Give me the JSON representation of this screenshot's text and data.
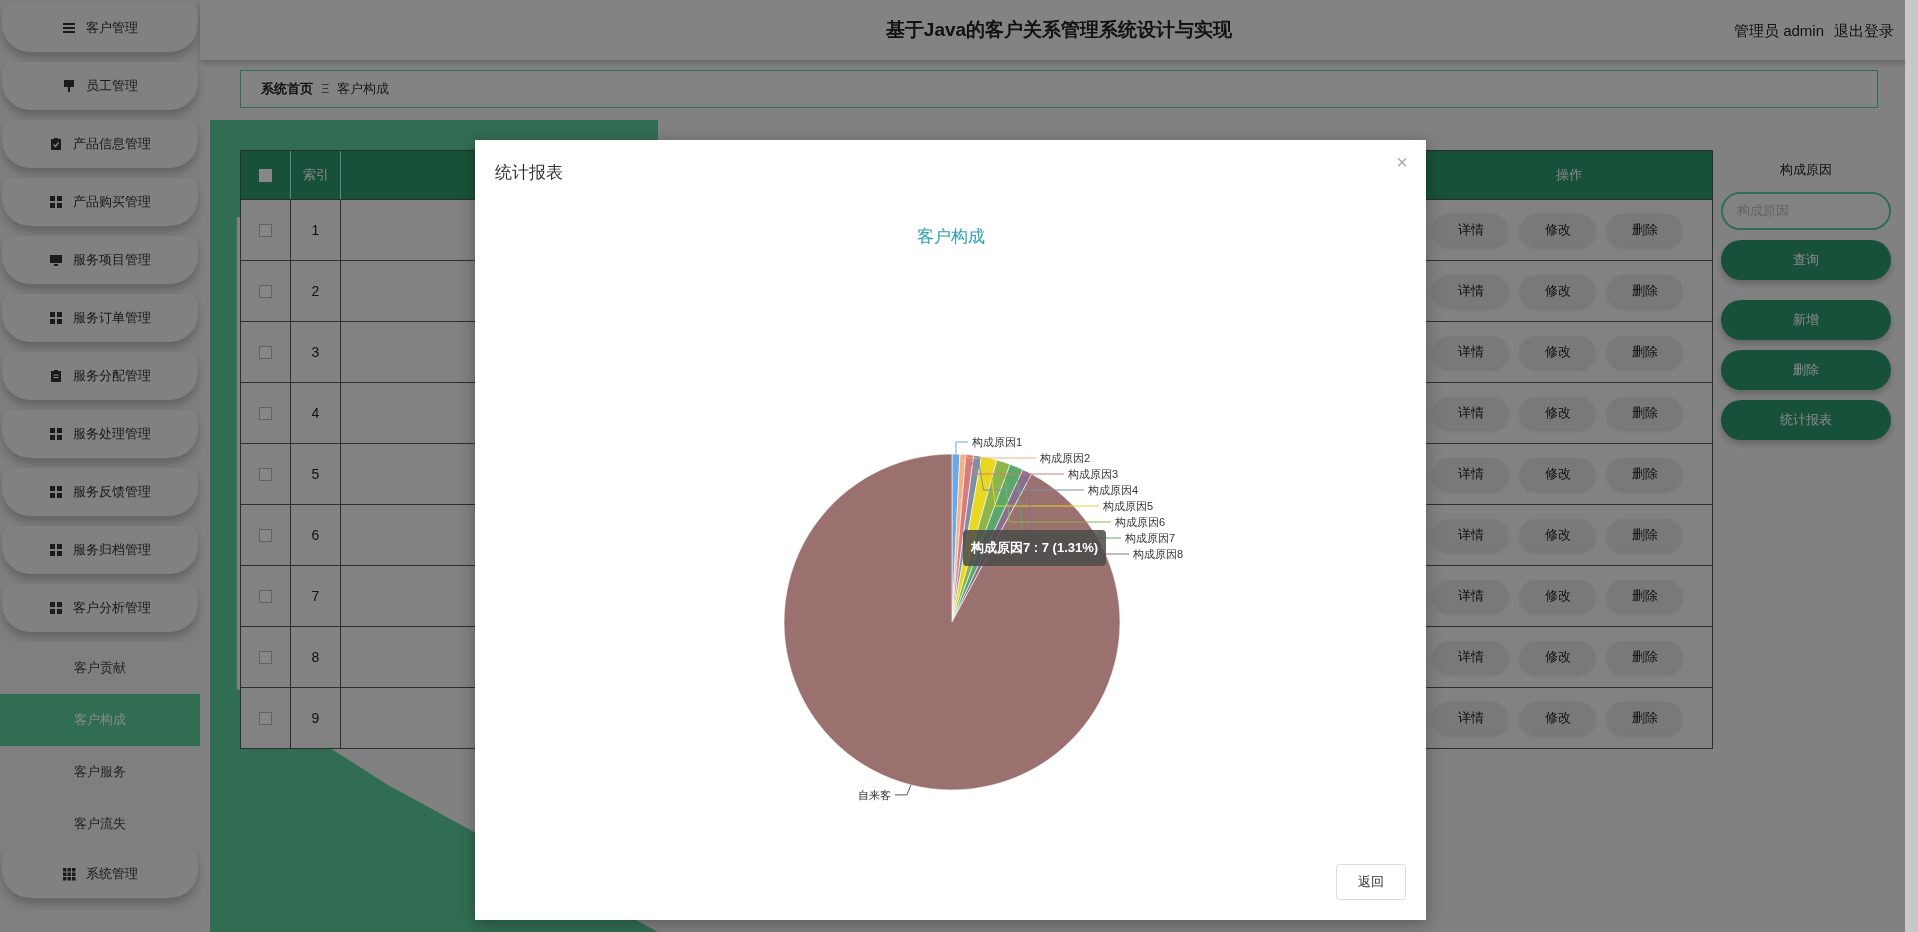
{
  "header": {
    "title": "基于Java的客户关系管理系统设计与实现",
    "user": "管理员 admin",
    "logout": "退出登录"
  },
  "sidebar": {
    "items": [
      {
        "label": "客户管理",
        "kind": "list"
      },
      {
        "label": "员工管理",
        "kind": "stand"
      },
      {
        "label": "产品信息管理",
        "kind": "checklist"
      },
      {
        "label": "产品购买管理",
        "kind": "grid"
      },
      {
        "label": "服务项目管理",
        "kind": "monitor"
      },
      {
        "label": "服务订单管理",
        "kind": "grid"
      },
      {
        "label": "服务分配管理",
        "kind": "clipboard"
      },
      {
        "label": "服务处理管理",
        "kind": "grid"
      },
      {
        "label": "服务反馈管理",
        "kind": "grid"
      },
      {
        "label": "服务归档管理",
        "kind": "grid"
      },
      {
        "label": "客户分析管理",
        "kind": "grid",
        "children": [
          {
            "label": "客户贡献",
            "selected": false
          },
          {
            "label": "客户构成",
            "selected": true
          },
          {
            "label": "客户服务",
            "selected": false
          },
          {
            "label": "客户流失",
            "selected": false
          }
        ]
      },
      {
        "label": "系统管理",
        "kind": "apps"
      }
    ]
  },
  "breadcrumb": {
    "items": [
      "系统首页",
      "客户构成"
    ],
    "separator": "Ξ"
  },
  "table": {
    "header_checkbox": {
      "checked": false
    },
    "columns": [
      "索引",
      "操作"
    ],
    "rows": [
      {
        "index": "1",
        "checked": false,
        "actions": [
          "详情",
          "修改",
          "删除"
        ]
      },
      {
        "index": "2",
        "checked": false,
        "actions": [
          "详情",
          "修改",
          "删除"
        ]
      },
      {
        "index": "3",
        "checked": false,
        "actions": [
          "详情",
          "修改",
          "删除"
        ]
      },
      {
        "index": "4",
        "checked": false,
        "actions": [
          "详情",
          "修改",
          "删除"
        ]
      },
      {
        "index": "5",
        "checked": false,
        "actions": [
          "详情",
          "修改",
          "删除"
        ]
      },
      {
        "index": "6",
        "checked": false,
        "actions": [
          "详情",
          "修改",
          "删除"
        ]
      },
      {
        "index": "7",
        "checked": false,
        "actions": [
          "详情",
          "修改",
          "删除"
        ]
      },
      {
        "index": "8",
        "checked": false,
        "actions": [
          "详情",
          "修改",
          "删除"
        ]
      },
      {
        "index": "9",
        "checked": false,
        "actions": [
          "详情",
          "修改",
          "删除"
        ]
      }
    ]
  },
  "search": {
    "label": "构成原因",
    "placeholder": "构成原因",
    "buttons": [
      "查询",
      "新增",
      "删除",
      "统计报表"
    ]
  },
  "modal": {
    "title": "统计报表",
    "close": "×",
    "tooltip": "构成原因7 : 7 (1.31%)",
    "footer_button": "返回",
    "chart_data": {
      "type": "pie",
      "title": "客户构成",
      "categories": [
        "构成原因1",
        "构成原因2",
        "构成原因3",
        "构成原因4",
        "构成原因5",
        "构成原因6",
        "构成原因7",
        "构成原因8",
        "自来客"
      ],
      "values": [
        4,
        3,
        4,
        4,
        8,
        7,
        7,
        5,
        492
      ]
    }
  }
}
